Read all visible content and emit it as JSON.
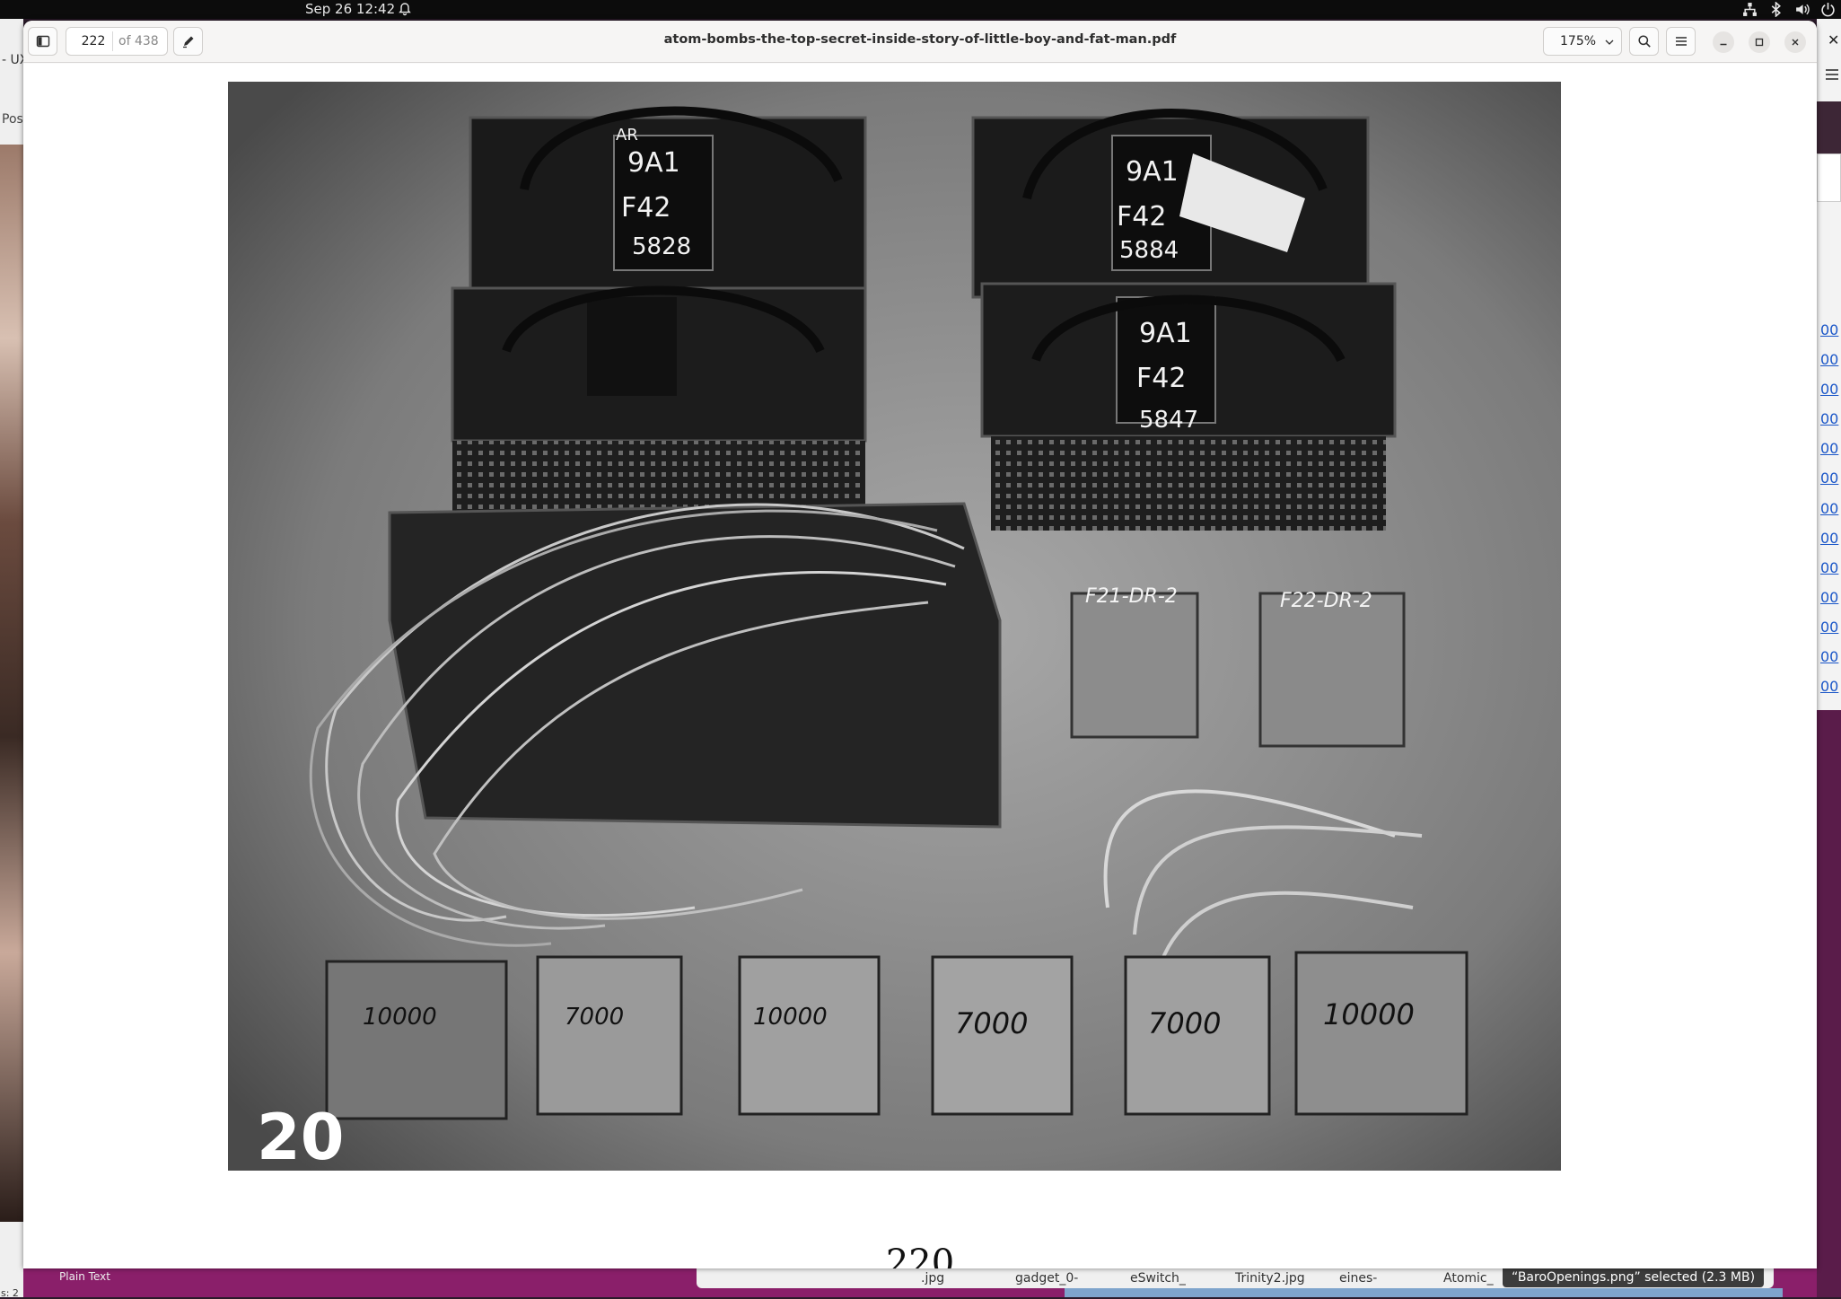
{
  "topbar": {
    "clock": "Sep 26  12:42"
  },
  "background_left": {
    "tab_text": "- UX",
    "panel_text": "Pos",
    "status_text": "s: 2"
  },
  "background_right": {
    "close_glyph": "✕",
    "links": [
      "00",
      "00",
      "00",
      "00",
      "00",
      "00",
      "00",
      "00",
      "00",
      "00",
      "00",
      "00",
      "00"
    ]
  },
  "bottom_strip": {
    "plain_text": "Plain Text",
    "files": [
      ".jpg",
      "gadget_0-",
      "eSwitch_",
      "Trinity2.jpg",
      "eines-",
      "Atomic_"
    ],
    "selected": "“BaroOpenings.png” selected  (2.3 MB)"
  },
  "viewer": {
    "title": "atom-bombs-the-top-secret-inside-story-of-little-boy-and-fat-man.pdf",
    "page_current": "222",
    "page_total": "of 438",
    "zoom": "175%",
    "document_page_number": "220"
  },
  "photo_labels": {
    "box1_code": "9A1",
    "box1_model": "F42",
    "box1_serial": "5828",
    "box2_code": "9A1",
    "box2_model": "F42",
    "box2_serial": "5884",
    "box4_code": "9A1",
    "box4_model": "F42",
    "box4_serial": "5847",
    "ar_mark": "AR",
    "small_box1": "F21-DR-2",
    "small_box2": "F22-DR-2",
    "corner_mark": "20",
    "unit_labels": [
      "10000",
      "7000",
      "10000",
      "7000",
      "7000",
      "10000"
    ]
  },
  "icons": {
    "sidebar": "sidebar-toggle-icon",
    "annotate": "pencil-icon",
    "search": "search-icon",
    "menu": "hamburger-menu-icon",
    "minimize": "minimize-icon",
    "maximize": "maximize-icon",
    "close": "close-icon"
  }
}
